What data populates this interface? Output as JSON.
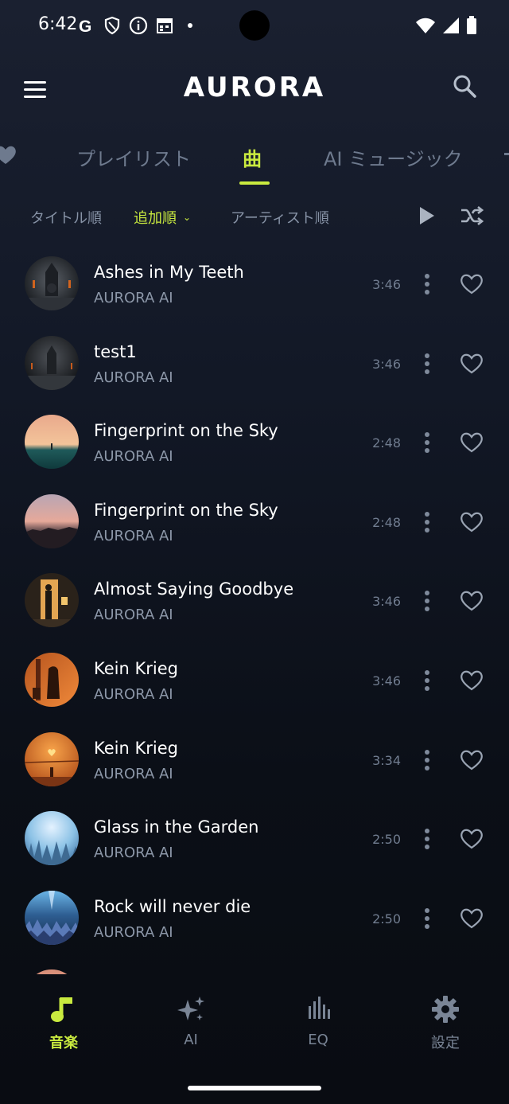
{
  "status_bar": {
    "time": "6:42",
    "icons_left": [
      "google-icon",
      "shield-icon",
      "info-icon",
      "calendar-icon",
      "dot-icon"
    ],
    "icons_right": [
      "wifi-icon",
      "signal-icon",
      "battery-icon"
    ]
  },
  "header": {
    "logo": "AURORA",
    "menu_icon": "hamburger-menu-icon",
    "search_icon": "search-icon"
  },
  "tabs": [
    {
      "label": "",
      "icon": "heart-icon"
    },
    {
      "label": "プレイリスト"
    },
    {
      "label": "曲",
      "active": true
    },
    {
      "label": "AI ミュージック"
    }
  ],
  "sort": {
    "title_order": "タイトル順",
    "added_order": "追加順",
    "artist_order": "アーティスト順",
    "active": "追加順"
  },
  "songs": [
    {
      "title": "Ashes in My Teeth",
      "artist": "AURORA AI",
      "duration": "3:46"
    },
    {
      "title": "test1",
      "artist": "AURORA AI",
      "duration": "3:46"
    },
    {
      "title": "Fingerprint on the Sky",
      "artist": "AURORA AI",
      "duration": "2:48"
    },
    {
      "title": "Fingerprint on the Sky",
      "artist": "AURORA AI",
      "duration": "2:48"
    },
    {
      "title": "Almost Saying Goodbye",
      "artist": "AURORA AI",
      "duration": "3:46"
    },
    {
      "title": "Kein Krieg",
      "artist": "AURORA AI",
      "duration": "3:46"
    },
    {
      "title": "Kein Krieg",
      "artist": "AURORA AI",
      "duration": "3:34"
    },
    {
      "title": "Glass in the Garden",
      "artist": "AURORA AI",
      "duration": "2:50"
    },
    {
      "title": "Rock will never die",
      "artist": "AURORA AI",
      "duration": "2:50"
    }
  ],
  "bottom_nav": [
    {
      "label": "音楽",
      "icon": "music-note-icon",
      "active": true
    },
    {
      "label": "AI",
      "icon": "sparkle-icon"
    },
    {
      "label": "EQ",
      "icon": "equalizer-icon"
    },
    {
      "label": "設定",
      "icon": "gear-icon"
    }
  ],
  "colors": {
    "accent": "#c9ea3f",
    "background": "#0b0f17",
    "muted_text": "#8c97a8"
  }
}
